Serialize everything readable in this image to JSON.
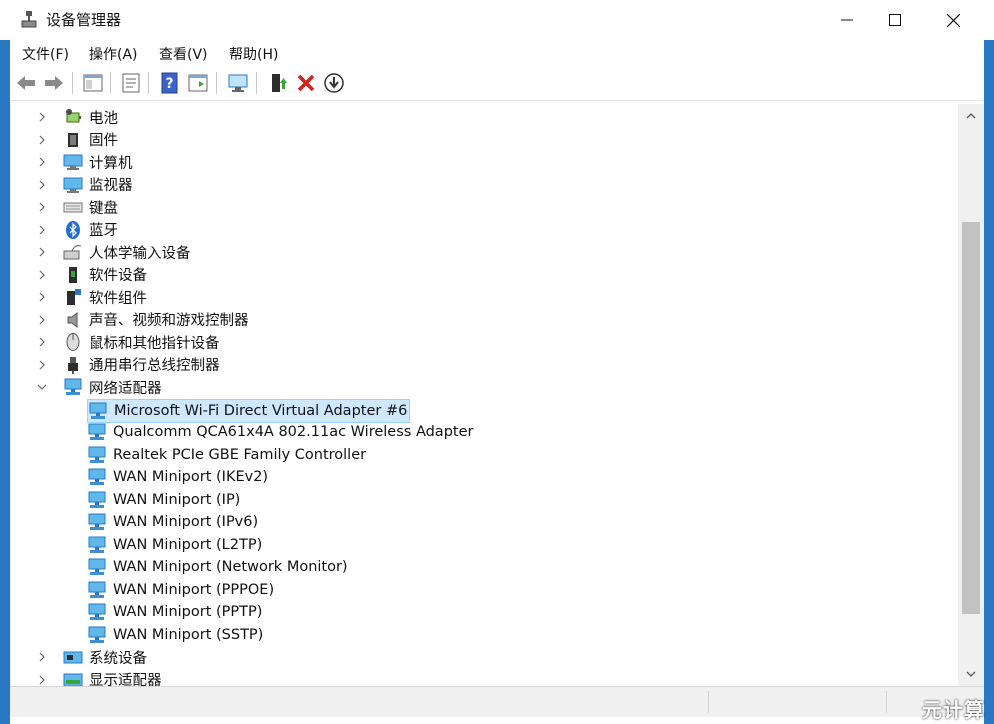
{
  "window": {
    "title": "设备管理器"
  },
  "menu": [
    {
      "label": "文件(F)"
    },
    {
      "label": "操作(A)"
    },
    {
      "label": "查看(V)"
    },
    {
      "label": "帮助(H)"
    }
  ],
  "tree": {
    "categories": [
      {
        "label": "电池",
        "icon": "battery-icon"
      },
      {
        "label": "固件",
        "icon": "firmware-icon"
      },
      {
        "label": "计算机",
        "icon": "computer-icon"
      },
      {
        "label": "监视器",
        "icon": "monitor-icon"
      },
      {
        "label": "键盘",
        "icon": "keyboard-icon"
      },
      {
        "label": "蓝牙",
        "icon": "bluetooth-icon"
      },
      {
        "label": "人体学输入设备",
        "icon": "hid-icon"
      },
      {
        "label": "软件设备",
        "icon": "software-device-icon"
      },
      {
        "label": "软件组件",
        "icon": "software-component-icon"
      },
      {
        "label": "声音、视频和游戏控制器",
        "icon": "speaker-icon"
      },
      {
        "label": "鼠标和其他指针设备",
        "icon": "mouse-icon"
      },
      {
        "label": "通用串行总线控制器",
        "icon": "usb-icon"
      }
    ],
    "network_category": {
      "label": "网络适配器",
      "icon": "network-adapter-icon"
    },
    "adapters": [
      {
        "label": "Microsoft Wi-Fi Direct Virtual Adapter #6",
        "selected": true
      },
      {
        "label": "Qualcomm QCA61x4A 802.11ac Wireless Adapter"
      },
      {
        "label": "Realtek PCIe GBE Family Controller"
      },
      {
        "label": "WAN Miniport (IKEv2)"
      },
      {
        "label": "WAN Miniport (IP)"
      },
      {
        "label": "WAN Miniport (IPv6)"
      },
      {
        "label": "WAN Miniport (L2TP)"
      },
      {
        "label": "WAN Miniport (Network Monitor)"
      },
      {
        "label": "WAN Miniport (PPPOE)"
      },
      {
        "label": "WAN Miniport (PPTP)"
      },
      {
        "label": "WAN Miniport (SSTP)"
      }
    ],
    "after": [
      {
        "label": "系统设备",
        "icon": "system-device-icon"
      },
      {
        "label": "显示适配器",
        "icon": "display-adapter-icon"
      }
    ]
  },
  "watermark": "元计算",
  "colors": {
    "selection": "#cde8ff",
    "accent": "#2a78c2"
  }
}
